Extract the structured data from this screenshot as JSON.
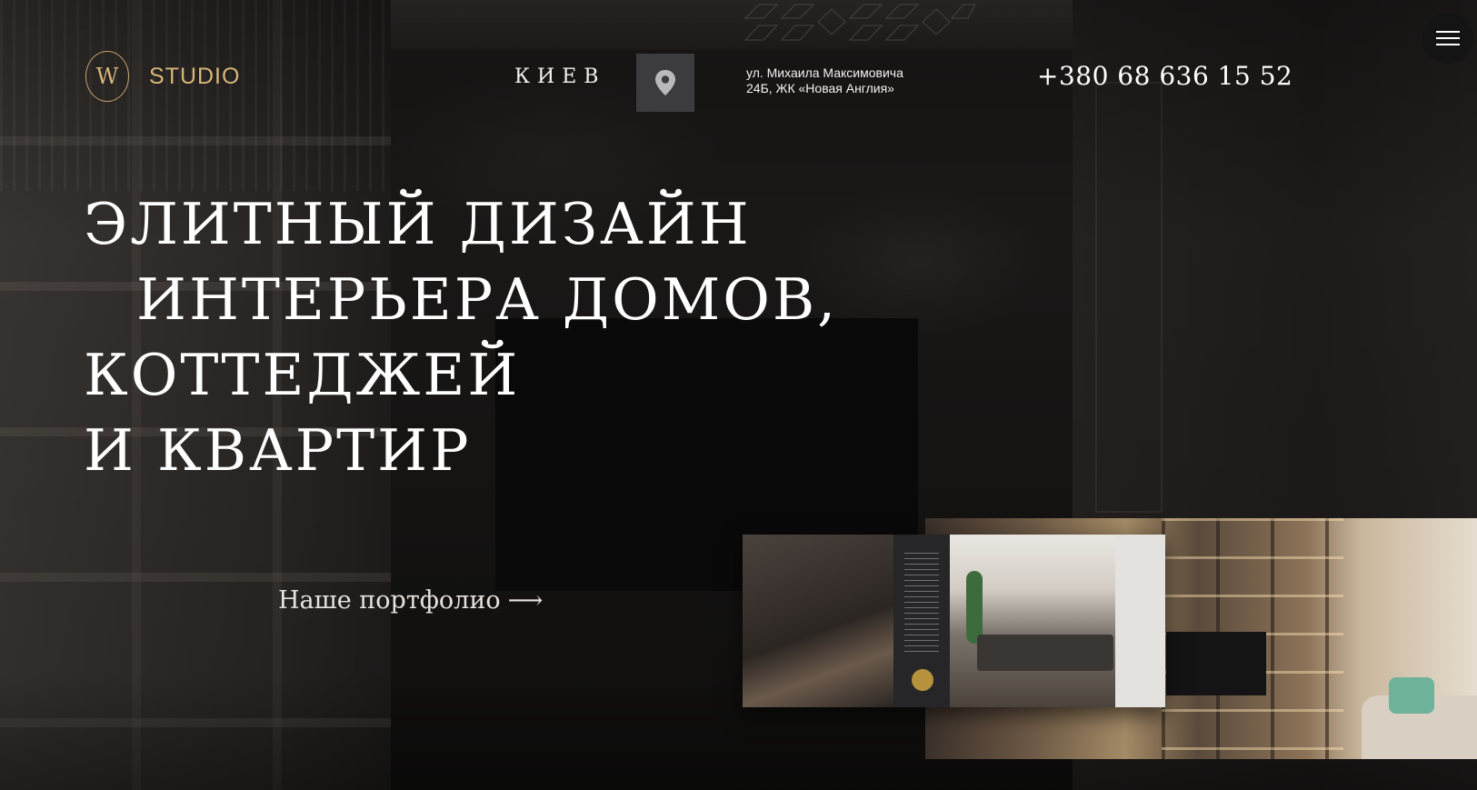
{
  "header": {
    "logo_letter": "W",
    "logo_text": "STUDIO",
    "city": "КИЕВ",
    "address_line1": "ул. Михаила Максимовича",
    "address_line2": "24Б, ЖК «Новая Англия»",
    "phone": "+380 68 636 15 52"
  },
  "hero": {
    "title_line1": "ЭЛИТНЫЙ ДИЗАЙН",
    "title_line2": "ИНТЕРЬЕРА ДОМОВ,",
    "title_line3": "КОТТЕДЖЕЙ",
    "title_line4": "И КВАРТИР",
    "portfolio_link": "Наше портфолио",
    "portfolio_arrow": "⟶"
  },
  "icons": {
    "map": "map-pin-icon",
    "menu": "hamburger-menu-icon"
  },
  "colors": {
    "accent_gold": "#d8b67a",
    "text": "#ffffff",
    "map_button_bg": "#3c3c3e"
  }
}
